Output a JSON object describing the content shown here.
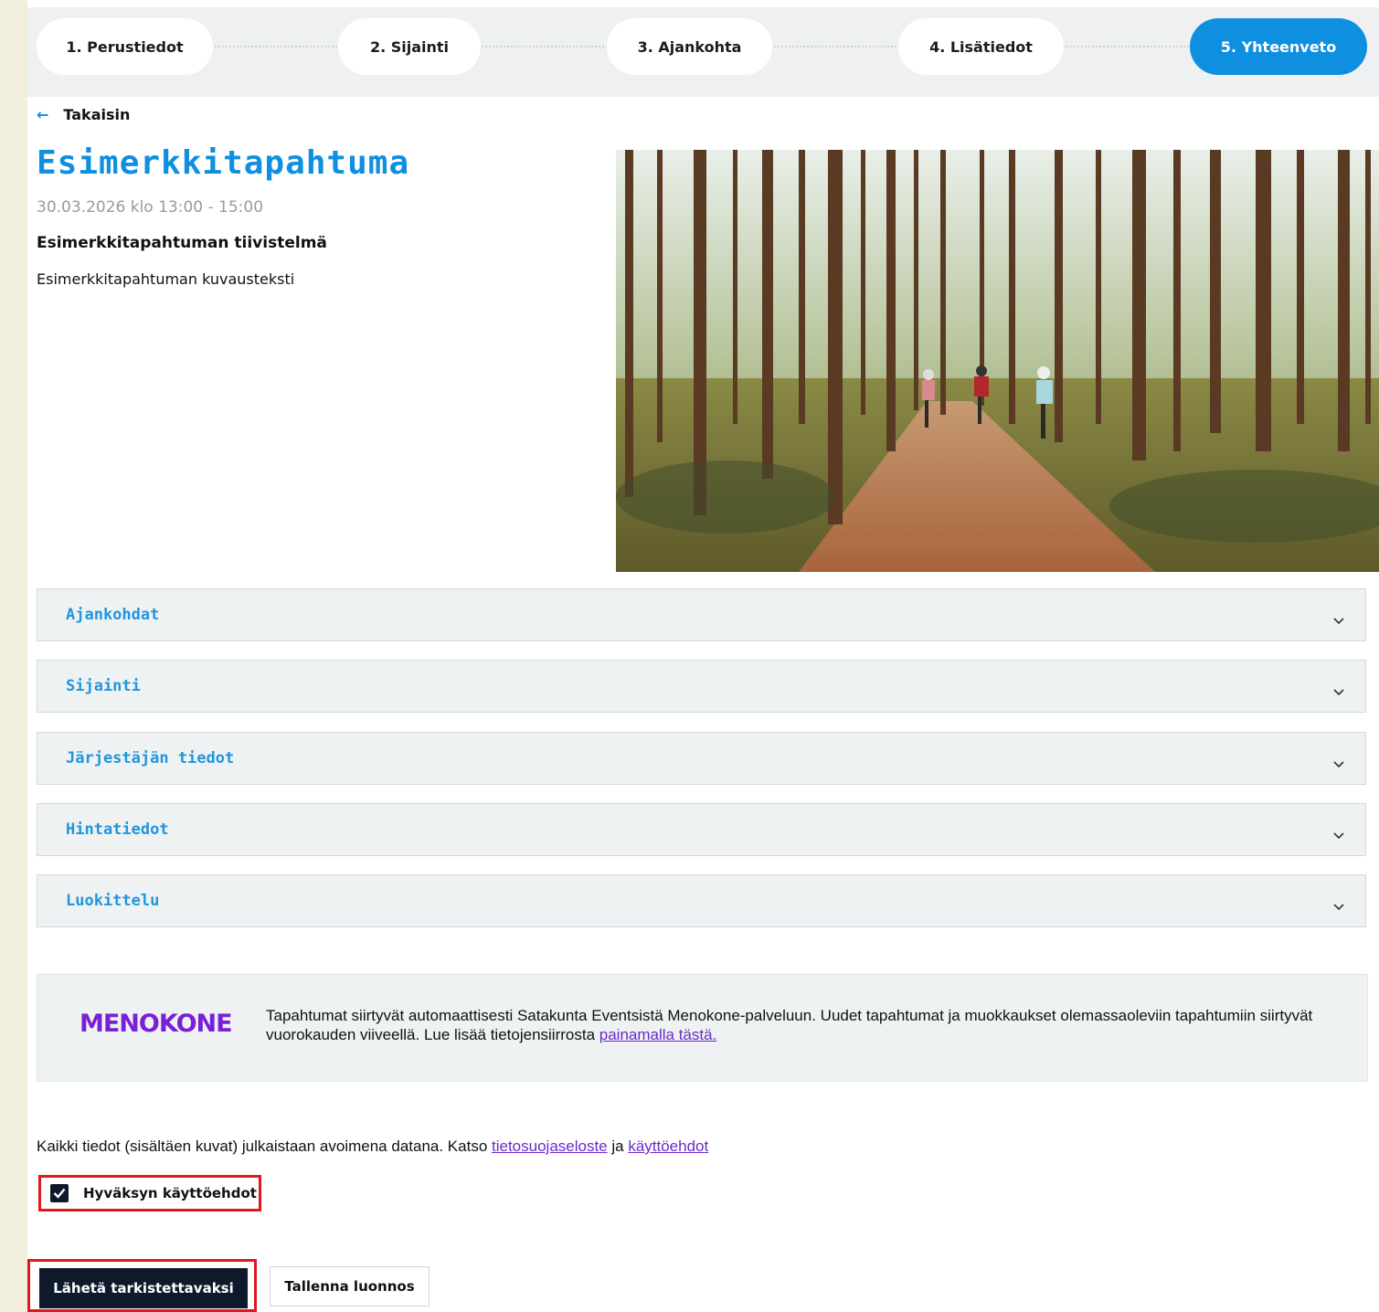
{
  "steps": [
    {
      "label": "1. Perustiedot",
      "active": false
    },
    {
      "label": "2. Sijainti",
      "active": false
    },
    {
      "label": "3. Ajankohta",
      "active": false
    },
    {
      "label": "4. Lisätiedot",
      "active": false
    },
    {
      "label": "5. Yhteenveto",
      "active": true
    }
  ],
  "back": {
    "arrow": "←",
    "label": "Takaisin"
  },
  "event": {
    "title": "Esimerkkitapahtuma",
    "datetime": "30.03.2026 klo 13:00 - 15:00",
    "summary": "Esimerkkitapahtuman tiivistelmä",
    "description": "Esimerkkitapahtuman kuvausteksti",
    "image": "photo of three cyclists riding on a forest path among pine trees"
  },
  "accordions": [
    {
      "label": "Ajankohdat"
    },
    {
      "label": "Sijainti"
    },
    {
      "label": "Järjestäjän tiedot"
    },
    {
      "label": "Hintatiedot"
    },
    {
      "label": "Luokittelu"
    }
  ],
  "menokone": {
    "logo": "MENOKONE",
    "text": "Tapahtumat siirtyvät automaattisesti Satakunta Eventsistä Menokone-palveluun. Uudet tapahtumat ja muokkaukset olemassaoleviin tapahtumiin siirtyvät vuorokauden viiveellä. Lue lisää tietojensiirrosta ",
    "link": "painamalla tästä."
  },
  "terms": {
    "text": "Kaikki tiedot (sisältäen kuvat) julkaistaan avoimena datana. Katso ",
    "privacy_link": "tietosuojaseloste",
    "and": " ja ",
    "terms_link": "käyttöehdot",
    "checkbox_label": "Hyväksyn käyttöehdot",
    "checked": true
  },
  "buttons": {
    "submit": "Lähetä tarkistettavaksi",
    "draft": "Tallenna luonnos"
  },
  "colors": {
    "accent": "#0f8fe0",
    "dark": "#0e1a2b",
    "highlight_border": "#e0181e",
    "menokone": "#7a1fd6"
  }
}
